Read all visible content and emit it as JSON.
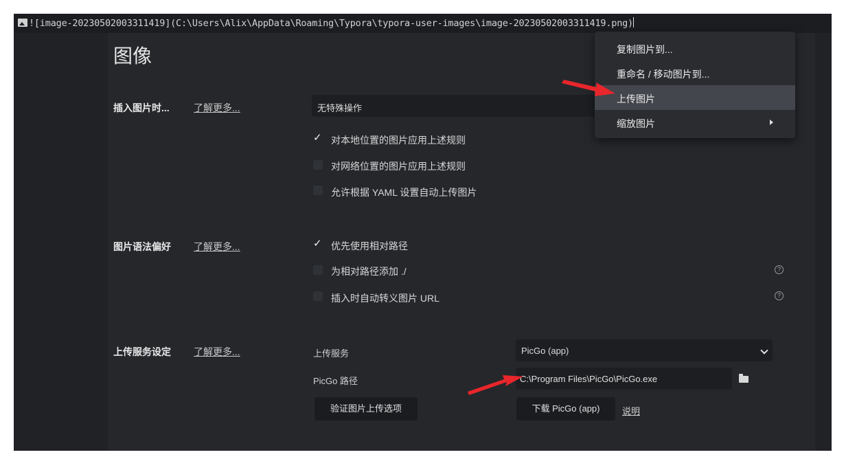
{
  "source_line": {
    "text": "![image-20230502003311419](C:\\Users\\Alix\\AppData\\Roaming\\Typora\\typora-user-images\\image-20230502003311419.png)"
  },
  "page": {
    "title": "图像"
  },
  "insert_section": {
    "label": "插入图片时...",
    "learn_more": "了解更多...",
    "select_value": "无特殊操作",
    "checkboxes": [
      {
        "label": "对本地位置的图片应用上述规则",
        "checked": true
      },
      {
        "label": "对网络位置的图片应用上述规则",
        "checked": false
      },
      {
        "label": "允许根据 YAML 设置自动上传图片",
        "checked": false
      }
    ]
  },
  "syntax_section": {
    "label": "图片语法偏好",
    "learn_more": "了解更多...",
    "checkboxes": [
      {
        "label": "优先使用相对路径",
        "checked": true
      },
      {
        "label": "为相对路径添加 ./",
        "checked": false
      },
      {
        "label": "插入时自动转义图片 URL",
        "checked": false
      }
    ],
    "help_glyph": "?"
  },
  "upload_section": {
    "label": "上传服务设定",
    "learn_more": "了解更多...",
    "service_label": "上传服务",
    "service_value": "PicGo (app)",
    "path_label": "PicGo 路径",
    "path_value": "C:\\Program Files\\PicGo\\PicGo.exe",
    "verify_button": "验证图片上传选项",
    "download_button": "下载 PicGo (app)",
    "help_link": "说明"
  },
  "context_menu": {
    "items": [
      {
        "label": "复制图片到...",
        "active": false,
        "submenu": false
      },
      {
        "label": "重命名 / 移动图片到...",
        "active": false,
        "submenu": false
      },
      {
        "label": "上传图片",
        "active": true,
        "submenu": false
      },
      {
        "label": "缩放图片",
        "active": false,
        "submenu": true
      }
    ]
  },
  "colors": {
    "background": "#202225",
    "panel": "#25272b",
    "menu_active": "#43464c",
    "annotation_arrow": "#e8262b"
  }
}
